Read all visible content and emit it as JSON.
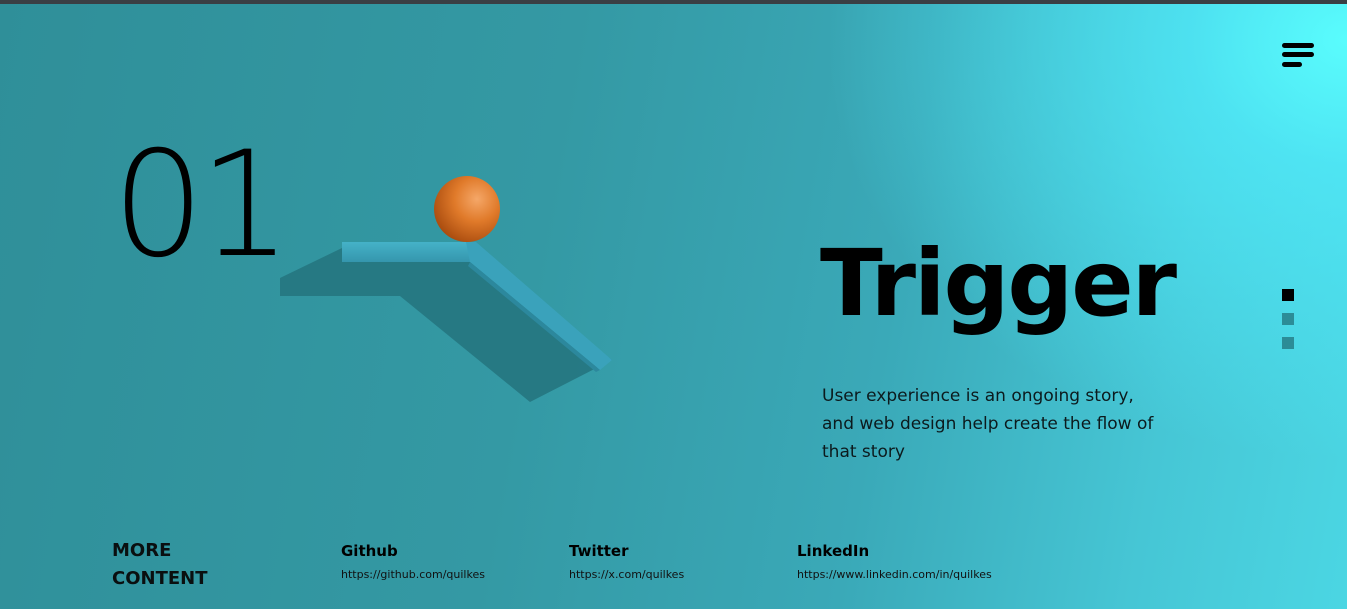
{
  "slide": {
    "number": "01",
    "title": "Trigger",
    "description": "User experience is an ongoing story, and web design help create the flow of that story"
  },
  "navigation": {
    "menu_icon": "hamburger-menu-icon",
    "dots": [
      {
        "state": "active"
      },
      {
        "state": "inactive"
      },
      {
        "state": "inactive"
      }
    ]
  },
  "footer": {
    "heading_line1": "MORE",
    "heading_line2": "CONTENT",
    "links": [
      {
        "title": "Github",
        "url": "https://github.com/quilkes"
      },
      {
        "title": "Twitter",
        "url": "https://x.com/quilkes"
      },
      {
        "title": "LinkedIn",
        "url": "https://www.linkedin.com/in/quilkes"
      }
    ]
  },
  "colors": {
    "background_start": "#2f8f99",
    "background_glow": "#5afcff",
    "text": "#000000",
    "ball": "#e07a2a",
    "ramp": "#3aa2bb",
    "ramp_shadow": "#25757f",
    "dot_active": "#000000",
    "dot_inactive": "#2c8c97"
  }
}
